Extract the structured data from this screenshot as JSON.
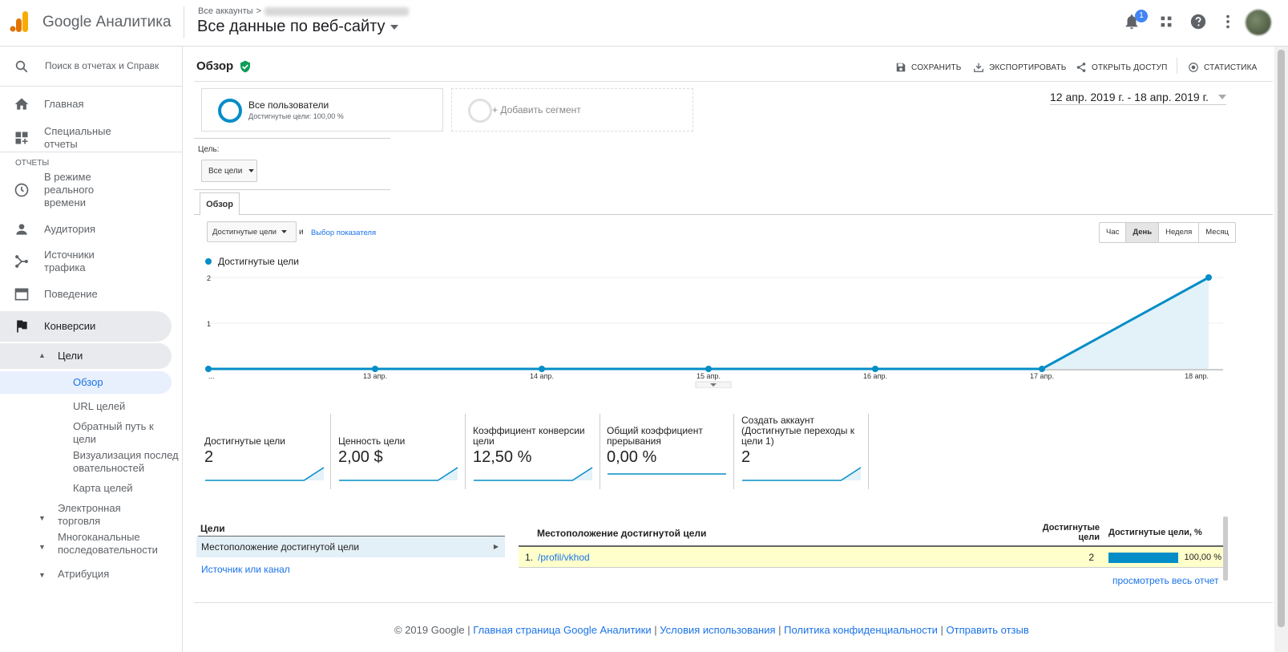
{
  "app": {
    "logo_text": "Google Аналитика"
  },
  "header": {
    "breadcrumb_root": "Все аккаунты",
    "breadcrumb_sep": ">",
    "view_name": "Все данные по веб-сайту",
    "notifications_count": "1"
  },
  "sidebar": {
    "search_placeholder": "Поиск в отчетах и Справке",
    "home": "Главная",
    "custom_reports": "Специальные отчеты",
    "section_reports": "ОТЧЕТЫ",
    "realtime": "В режиме реального времени",
    "audience": "Аудитория",
    "acquisition": "Источники трафика",
    "behavior": "Поведение",
    "conversions": "Конверсии",
    "goals": "Цели",
    "goals_sub": [
      "Обзор",
      "URL целей",
      "Обратный путь к цели",
      "Визуализация последовательностей",
      "Карта целей"
    ],
    "ecommerce": "Электронная торговля",
    "multichannel": "Многоканальные последовательности",
    "attribution": "Атрибуция"
  },
  "page": {
    "title": "Обзор",
    "actions": {
      "save": "СОХРАНИТЬ",
      "export": "ЭКСПОРТИРОВАТЬ",
      "share": "ОТКРЫТЬ ДОСТУП",
      "insights": "СТАТИСТИКА"
    },
    "segment_name": "Все пользователи",
    "segment_sub": "Достигнутые цели: 100,00 %",
    "add_segment": "+ Добавить сегмент",
    "date_range": "12 апр. 2019 г. - 18 апр. 2019 г.",
    "goal_label": "Цель:",
    "goal_select": "Все цели",
    "tab": "Обзор",
    "metric_select": "Достигнутые цели",
    "and": "и",
    "choose_metric": "Выбор показателя",
    "periods": [
      "Час",
      "День",
      "Неделя",
      "Месяц"
    ],
    "active_period": "День"
  },
  "chart_data": {
    "type": "area",
    "series": [
      {
        "name": "Достигнутые цели",
        "values": [
          0,
          0,
          0,
          0,
          0,
          0,
          2
        ]
      }
    ],
    "categories": [
      "...",
      "13 апр.",
      "14 апр.",
      "15 апр.",
      "16 апр.",
      "17 апр.",
      "18 апр."
    ],
    "y_ticks": [
      "1",
      "2"
    ],
    "ylim": [
      0,
      2
    ],
    "color": "#058dc7",
    "fill": "#e3f1f9",
    "grid": true,
    "legend": "top-left"
  },
  "scorecards": [
    {
      "title": "Достигнутые цели",
      "value": "2",
      "spark": [
        0,
        0,
        0,
        0,
        0,
        0,
        2
      ]
    },
    {
      "title": "Ценность цели",
      "value": "2,00 $",
      "spark": [
        0,
        0,
        0,
        0,
        0,
        0,
        2
      ]
    },
    {
      "title": "Коэффициент конверсии цели",
      "value": "12,50 %",
      "spark": [
        0,
        0,
        0,
        0,
        0,
        0,
        2
      ]
    },
    {
      "title": "Общий коэффициент прерывания",
      "value": "0,00 %",
      "spark": [
        0,
        0,
        0,
        0,
        0,
        0,
        0
      ]
    },
    {
      "title": "Создать аккаунт (Достигнутые переходы к цели 1)",
      "value": "2",
      "spark": [
        0,
        0,
        0,
        0,
        0,
        0,
        2
      ]
    }
  ],
  "goals_panel": {
    "header": "Цели",
    "selected": "Местоположение достигнутой цели",
    "other": "Источник или канал"
  },
  "report_table": {
    "col_location": "Местоположение достигнутой цели",
    "col_completions": "Достигнутые цели",
    "col_percent": "Достигнутые цели, %",
    "rows": [
      {
        "index": "1.",
        "path": "/profil/vkhod",
        "completions": "2",
        "percent": "100,00 %",
        "percent_value": 100
      }
    ],
    "view_all": "просмотреть весь отчет"
  },
  "footer": {
    "copyright": "© 2019 Google",
    "links": [
      "Главная страница Google Аналитики",
      "Условия использования",
      "Политика конфиденциальности",
      "Отправить отзыв"
    ]
  }
}
